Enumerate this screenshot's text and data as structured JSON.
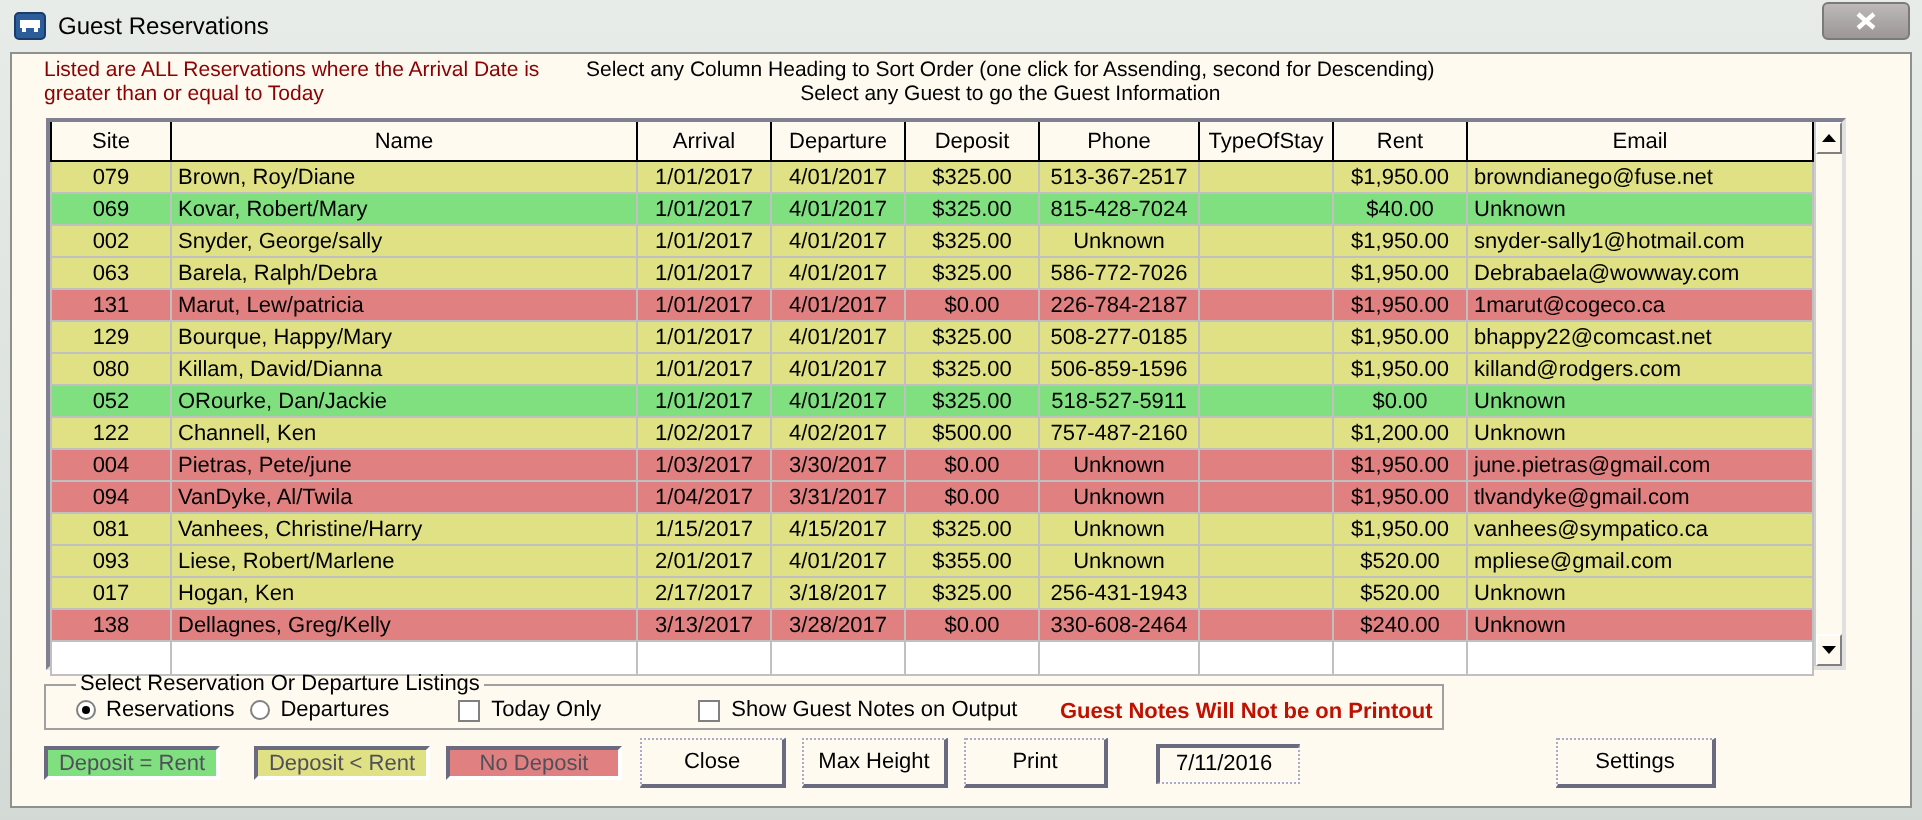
{
  "window": {
    "title": "Guest Reservations"
  },
  "notice": "Listed are ALL Reservations where the Arrival Date is greater than or equal to Today",
  "instructions": [
    "Select any Column Heading to Sort Order (one click for Assending, second for Descending)",
    "Select any Guest to go the Guest Information"
  ],
  "table": {
    "columns": [
      "Site",
      "Name",
      "Arrival",
      "Departure",
      "Deposit",
      "Phone",
      "TypeOfStay",
      "Rent",
      "Email"
    ],
    "rows": [
      {
        "color": "#e0e084",
        "cells": [
          "079",
          "Brown, Roy/Diane",
          "1/01/2017",
          "4/01/2017",
          "$325.00",
          "513-367-2517",
          "",
          "$1,950.00",
          "browndianego@fuse.net"
        ]
      },
      {
        "color": "#80e080",
        "cells": [
          "069",
          "Kovar, Robert/Mary",
          "1/01/2017",
          "4/01/2017",
          "$325.00",
          "815-428-7024",
          "",
          "$40.00",
          "Unknown"
        ]
      },
      {
        "color": "#e0e084",
        "cells": [
          "002",
          "Snyder, George/sally",
          "1/01/2017",
          "4/01/2017",
          "$325.00",
          "Unknown",
          "",
          "$1,950.00",
          "snyder-sally1@hotmail.com"
        ]
      },
      {
        "color": "#e0e084",
        "cells": [
          "063",
          "Barela, Ralph/Debra",
          "1/01/2017",
          "4/01/2017",
          "$325.00",
          "586-772-7026",
          "",
          "$1,950.00",
          "Debrabaela@wowway.com"
        ]
      },
      {
        "color": "#e08080",
        "cells": [
          "131",
          "Marut, Lew/patricia",
          "1/01/2017",
          "4/01/2017",
          "$0.00",
          "226-784-2187",
          "",
          "$1,950.00",
          "1marut@cogeco.ca"
        ]
      },
      {
        "color": "#e0e084",
        "cells": [
          "129",
          "Bourque, Happy/Mary",
          "1/01/2017",
          "4/01/2017",
          "$325.00",
          "508-277-0185",
          "",
          "$1,950.00",
          "bhappy22@comcast.net"
        ]
      },
      {
        "color": "#e0e084",
        "cells": [
          "080",
          "Killam, David/Dianna",
          "1/01/2017",
          "4/01/2017",
          "$325.00",
          "506-859-1596",
          "",
          "$1,950.00",
          "killand@rodgers.com"
        ]
      },
      {
        "color": "#80e080",
        "cells": [
          "052",
          "ORourke, Dan/Jackie",
          "1/01/2017",
          "4/01/2017",
          "$325.00",
          "518-527-5911",
          "",
          "$0.00",
          "Unknown"
        ]
      },
      {
        "color": "#e0e084",
        "cells": [
          "122",
          "Channell, Ken",
          "1/02/2017",
          "4/02/2017",
          "$500.00",
          "757-487-2160",
          "",
          "$1,200.00",
          "Unknown"
        ]
      },
      {
        "color": "#e08080",
        "cells": [
          "004",
          "Pietras, Pete/june",
          "1/03/2017",
          "3/30/2017",
          "$0.00",
          "Unknown",
          "",
          "$1,950.00",
          "june.pietras@gmail.com"
        ]
      },
      {
        "color": "#e08080",
        "cells": [
          "094",
          "VanDyke, Al/Twila",
          "1/04/2017",
          "3/31/2017",
          "$0.00",
          "Unknown",
          "",
          "$1,950.00",
          "tlvandyke@gmail.com"
        ]
      },
      {
        "color": "#e0e084",
        "cells": [
          "081",
          "Vanhees, Christine/Harry",
          "1/15/2017",
          "4/15/2017",
          "$325.00",
          "Unknown",
          "",
          "$1,950.00",
          "vanhees@sympatico.ca"
        ]
      },
      {
        "color": "#e0e084",
        "cells": [
          "093",
          "Liese, Robert/Marlene",
          "2/01/2017",
          "4/01/2017",
          "$355.00",
          "Unknown",
          "",
          "$520.00",
          "mpliese@gmail.com"
        ]
      },
      {
        "color": "#e0e084",
        "cells": [
          "017",
          "Hogan, Ken",
          "2/17/2017",
          "3/18/2017",
          "$325.00",
          "256-431-1943",
          "",
          "$520.00",
          "Unknown"
        ]
      },
      {
        "color": "#e08080",
        "cells": [
          "138",
          "Dellagnes, Greg/Kelly",
          "3/13/2017",
          "3/28/2017",
          "$0.00",
          "330-608-2464",
          "",
          "$240.00",
          "Unknown"
        ]
      }
    ]
  },
  "listing_group": {
    "title": "Select Reservation Or Departure Listings",
    "options": [
      {
        "label": "Reservations",
        "selected": true
      },
      {
        "label": "Departures",
        "selected": false
      }
    ],
    "checkboxes": [
      {
        "label": "Today Only",
        "checked": false
      },
      {
        "label": "Show Guest Notes on Output",
        "checked": false
      }
    ]
  },
  "warning": "Guest Notes Will Not be on Printout",
  "legend": [
    {
      "label": "Deposit = Rent",
      "color": "#80e080"
    },
    {
      "label": "Deposit < Rent",
      "color": "#e0e084"
    },
    {
      "label": "No Deposit",
      "color": "#e08080"
    }
  ],
  "buttons": {
    "close": "Close",
    "max_height": "Max Height",
    "print": "Print",
    "settings": "Settings"
  },
  "date_field": {
    "value": "7/11/2016"
  }
}
